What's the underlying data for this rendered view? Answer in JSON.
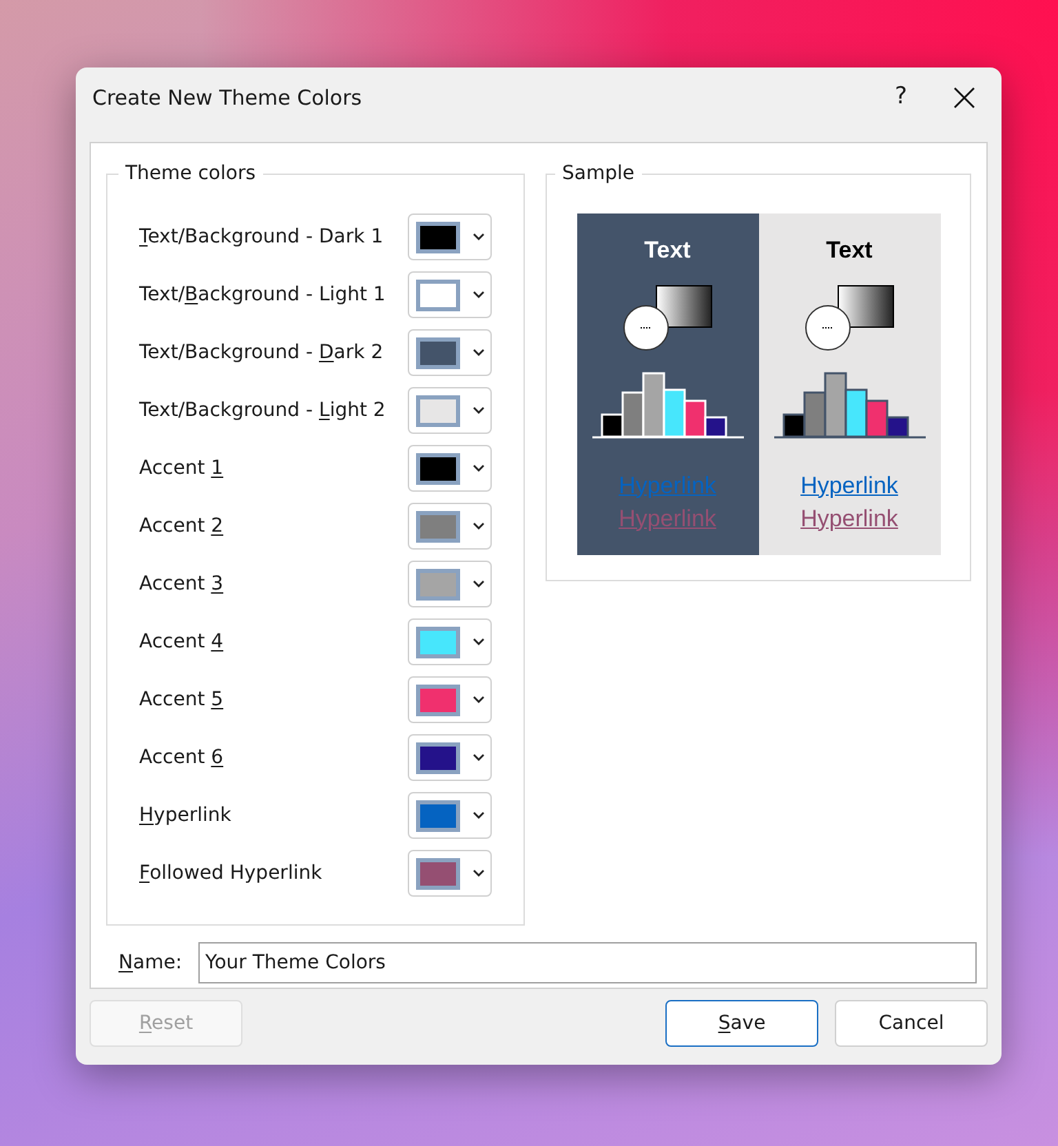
{
  "window": {
    "title": "Create New Theme Colors",
    "help": "?"
  },
  "theme_colors": {
    "title": "Theme colors",
    "items": [
      {
        "key": "T",
        "post": "ext/Background - Dark 1",
        "color": "#000000"
      },
      {
        "pre": "Text/",
        "key": "B",
        "post": "ackground - Light 1",
        "color": "#ffffff"
      },
      {
        "pre": "Text/Background - ",
        "key": "D",
        "post": "ark 2",
        "color": "#44546a"
      },
      {
        "pre": "Text/Background - ",
        "key": "L",
        "post": "ight 2",
        "color": "#e7e6e6"
      },
      {
        "pre": "Accent ",
        "key": "1",
        "color": "#000000"
      },
      {
        "pre": "Accent ",
        "key": "2",
        "color": "#7f7f7f"
      },
      {
        "pre": "Accent ",
        "key": "3",
        "color": "#a5a5a5"
      },
      {
        "pre": "Accent ",
        "key": "4",
        "color": "#47e6fc"
      },
      {
        "pre": "Accent ",
        "key": "5",
        "color": "#f0306e"
      },
      {
        "pre": "Accent ",
        "key": "6",
        "color": "#24128a"
      },
      {
        "key": "H",
        "post": "yperlink",
        "color": "#0563c1"
      },
      {
        "key": "F",
        "post": "ollowed Hyperlink",
        "color": "#954f72"
      }
    ]
  },
  "sample": {
    "title": "Sample",
    "panels": [
      {
        "heading": "Text",
        "hyperlink": "Hyperlink",
        "followed_hyperlink": "Hyperlink"
      },
      {
        "heading": "Text",
        "hyperlink": "Hyperlink",
        "followed_hyperlink": "Hyperlink"
      }
    ]
  },
  "name_field": {
    "key": "N",
    "post": "ame:",
    "value": "Your Theme Colors"
  },
  "buttons": [
    {
      "key": "R",
      "post": "eset",
      "disabled": true,
      "focused": false
    },
    {
      "key": "S",
      "post": "ave",
      "disabled": false,
      "focused": true
    },
    {
      "pre": "Cancel",
      "disabled": false,
      "focused": false
    }
  ]
}
